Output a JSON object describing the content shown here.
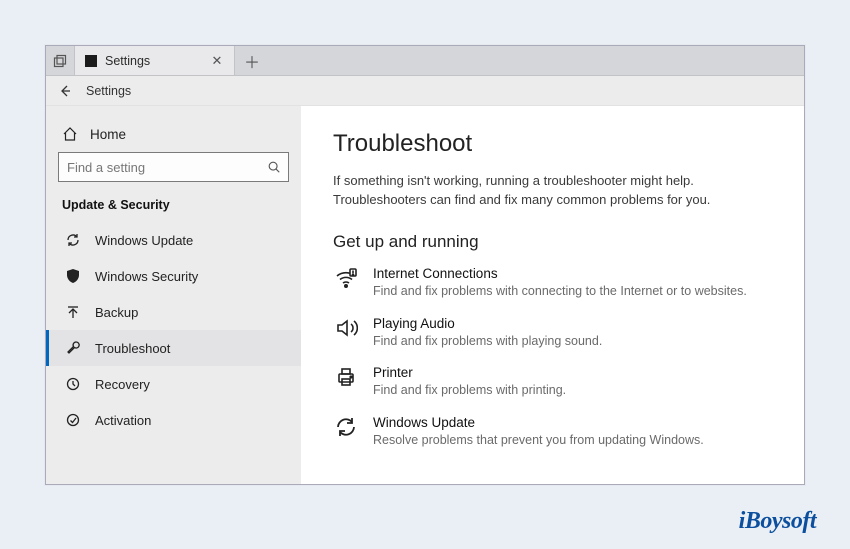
{
  "app": {
    "tab_title": "Settings",
    "header_label": "Settings"
  },
  "sidebar": {
    "home_label": "Home",
    "search_placeholder": "Find a setting",
    "section_label": "Update & Security",
    "items": [
      {
        "label": "Windows Update",
        "icon": "refresh"
      },
      {
        "label": "Windows Security",
        "icon": "shield"
      },
      {
        "label": "Backup",
        "icon": "backup"
      },
      {
        "label": "Troubleshoot",
        "icon": "wrench",
        "selected": true
      },
      {
        "label": "Recovery",
        "icon": "history"
      },
      {
        "label": "Activation",
        "icon": "activation"
      }
    ]
  },
  "main": {
    "title": "Troubleshoot",
    "intro": "If something isn't working, running a troubleshooter might help. Troubleshooters can find and fix many common problems for you.",
    "sub_heading": "Get up and running",
    "items": [
      {
        "title": "Internet Connections",
        "desc": "Find and fix problems with connecting to the Internet or to websites.",
        "icon": "wifi"
      },
      {
        "title": "Playing Audio",
        "desc": "Find and fix problems with playing sound.",
        "icon": "audio"
      },
      {
        "title": "Printer",
        "desc": "Find and fix problems with printing.",
        "icon": "printer"
      },
      {
        "title": "Windows Update",
        "desc": "Resolve problems that prevent you from updating Windows.",
        "icon": "refresh"
      }
    ]
  },
  "watermark": "iBoysoft"
}
